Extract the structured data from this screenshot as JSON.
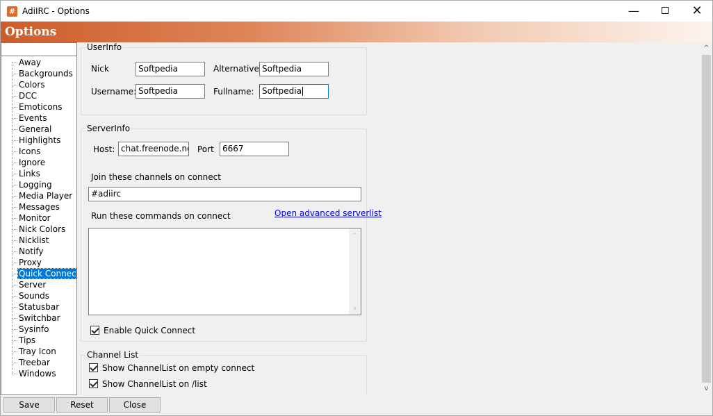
{
  "window": {
    "app_icon": "#",
    "title": "AdiIRC - Options",
    "minimize_glyph": "—",
    "close_glyph": "✕"
  },
  "banner": {
    "title": "Options"
  },
  "tree": {
    "search_value": "",
    "items": [
      "Away",
      "Backgrounds",
      "Colors",
      "DCC",
      "Emoticons",
      "Events",
      "General",
      "Highlights",
      "Icons",
      "Ignore",
      "Links",
      "Logging",
      "Media Player",
      "Messages",
      "Monitor",
      "Nick Colors",
      "Nicklist",
      "Notify",
      "Proxy",
      "Quick Connect",
      "Server",
      "Sounds",
      "Statusbar",
      "Switchbar",
      "Sysinfo",
      "Tips",
      "Tray Icon",
      "Treebar",
      "Windows"
    ],
    "selected": "Quick Connect"
  },
  "userinfo": {
    "title": "UserInfo",
    "nick_label": "Nick",
    "nick_value": "Softpedia",
    "alternative_label": "Alternative:",
    "alternative_value": "Softpedia",
    "username_label": "Username:",
    "username_value": "Softpedia",
    "fullname_label": "Fullname:",
    "fullname_value": "Softpedia"
  },
  "serverinfo": {
    "title": "ServerInfo",
    "host_label": "Host:",
    "host_value": "chat.freenode.net",
    "port_label": "Port",
    "port_value": "6667",
    "join_label": "Join these channels on connect",
    "join_value": "#adiirc",
    "commands_label": "Run these commands on connect",
    "advanced_link": "Open advanced serverlist",
    "commands_value": "",
    "enable_label": "Enable Quick Connect",
    "enable_checked": true
  },
  "channel_list": {
    "title": "Channel List",
    "empty_connect_label": "Show ChannelList on empty connect",
    "empty_connect_checked": true,
    "list_label": "Show ChannelList on /list",
    "list_checked": true
  },
  "buttons": {
    "save": "Save",
    "reset": "Reset",
    "close": "Close"
  },
  "icons": {
    "up_arrow": "^",
    "down_arrow": "v"
  }
}
